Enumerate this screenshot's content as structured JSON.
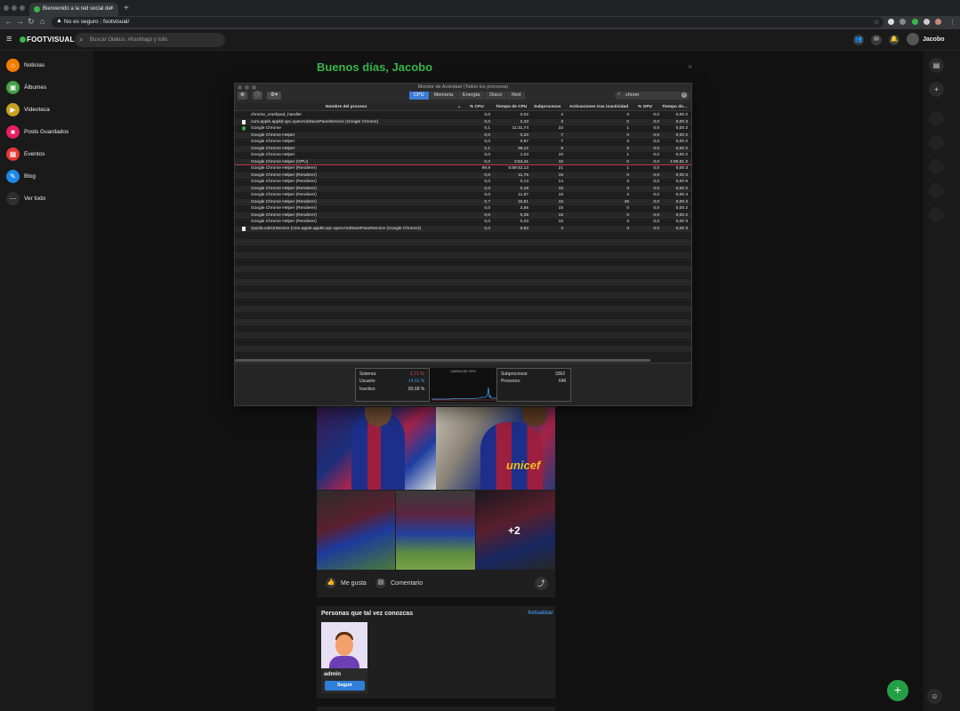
{
  "browser": {
    "tab_title": "Bienvenido a la red social del",
    "new_tab": "+",
    "security": "No es seguro",
    "url": "footvisual/"
  },
  "header": {
    "logo": "FOOTVISUAL",
    "search_placeholder": "Buscar Otakus, #hashtags y tolis",
    "username": "Jacobo"
  },
  "sidebar": {
    "items": [
      {
        "label": "Noticias",
        "color": "#f57c00",
        "icon": "home-icon"
      },
      {
        "label": "Álbumes",
        "color": "#43a047",
        "icon": "albums-icon"
      },
      {
        "label": "Videoteca",
        "color": "#c8a020",
        "icon": "video-icon"
      },
      {
        "label": "Posts Guardados",
        "color": "#e91e63",
        "icon": "bookmark-icon"
      },
      {
        "label": "Eventos",
        "color": "#e53935",
        "icon": "calendar-icon"
      },
      {
        "label": "Blog",
        "color": "#1e88e5",
        "icon": "blog-icon"
      },
      {
        "label": "Ver todo",
        "color": "#2e2e2e",
        "icon": "more-icon"
      }
    ]
  },
  "feed": {
    "greeting": "Buenos días, Jacobo",
    "more_photos": "+2",
    "jersey_text": "unicef",
    "like_label": "Me gusta",
    "comment_label": "Comentario"
  },
  "suggestions": {
    "title": "Personas que tal vez conozcas",
    "refresh": "Actualizar",
    "person_name": "admin",
    "follow_label": "Seguir"
  },
  "activity_monitor": {
    "title": "Monitor de Actividad (Todos los procesos)",
    "tabs": [
      "CPU",
      "Memoria",
      "Energía",
      "Disco",
      "Red"
    ],
    "active_tab": "CPU",
    "search_value": "chrom",
    "columns": [
      "Nombre del proceso",
      "% CPU",
      "Tiempo de CPU",
      "Subprocesos",
      "Activaciones tras inactividad",
      "% GPU",
      "Tiempo de..."
    ],
    "rows": [
      {
        "name": "chrome_crashpad_handler",
        "icon": "",
        "cpu": "0,0",
        "time": "0,02",
        "threads": "4",
        "wakeups": "0",
        "gpu": "0,0",
        "gtime": "0,00 2"
      },
      {
        "name": "com.apple.appkit.xpc.openAndSavePanelService (Google Chrome)",
        "icon": "doc",
        "cpu": "0,0",
        "time": "2,43",
        "threads": "3",
        "wakeups": "0",
        "gpu": "0,0",
        "gtime": "0,00 3"
      },
      {
        "name": "Google Chrome",
        "icon": "chrome",
        "cpu": "0,1",
        "time": "11:31,74",
        "threads": "32",
        "wakeups": "1",
        "gpu": "0,0",
        "gtime": "0,00 2"
      },
      {
        "name": "Google Chrome Helper",
        "icon": "",
        "cpu": "0,0",
        "time": "0,20",
        "threads": "7",
        "wakeups": "0",
        "gpu": "0,0",
        "gtime": "0,00 2"
      },
      {
        "name": "Google Chrome Helper",
        "icon": "",
        "cpu": "0,0",
        "time": "0,87",
        "threads": "7",
        "wakeups": "0",
        "gpu": "0,0",
        "gtime": "0,00 2"
      },
      {
        "name": "Google Chrome Helper",
        "icon": "",
        "cpu": "0,1",
        "time": "38,12",
        "threads": "9",
        "wakeups": "6",
        "gpu": "0,0",
        "gtime": "0,00 2"
      },
      {
        "name": "Google Chrome Helper",
        "icon": "",
        "cpu": "0,0",
        "time": "1,03",
        "threads": "10",
        "wakeups": "1",
        "gpu": "0,0",
        "gtime": "0,00 2"
      },
      {
        "name": "Google Chrome Helper (GPU)",
        "icon": "",
        "cpu": "0,0",
        "time": "3:54,41",
        "threads": "10",
        "wakeups": "0",
        "gpu": "0,0",
        "gtime": "1:00,61 2"
      },
      {
        "name": "Google Chrome Helper (Renderer)",
        "icon": "",
        "cpu": "99,9",
        "time": "5:59:42,13",
        "threads": "21",
        "wakeups": "1",
        "gpu": "0,0",
        "gtime": "0,00 3",
        "selected": true
      },
      {
        "name": "Google Chrome Helper (Renderer)",
        "icon": "",
        "cpu": "0,0",
        "time": "11,75",
        "threads": "15",
        "wakeups": "0",
        "gpu": "0,0",
        "gtime": "0,00 3"
      },
      {
        "name": "Google Chrome Helper (Renderer)",
        "icon": "",
        "cpu": "0,0",
        "time": "0,13",
        "threads": "14",
        "wakeups": "0",
        "gpu": "0,0",
        "gtime": "0,00 6"
      },
      {
        "name": "Google Chrome Helper (Renderer)",
        "icon": "",
        "cpu": "0,0",
        "time": "0,18",
        "threads": "15",
        "wakeups": "0",
        "gpu": "0,0",
        "gtime": "0,00 2"
      },
      {
        "name": "Google Chrome Helper (Renderer)",
        "icon": "",
        "cpu": "0,0",
        "time": "11,87",
        "threads": "16",
        "wakeups": "4",
        "gpu": "0,0",
        "gtime": "0,00 4"
      },
      {
        "name": "Google Chrome Helper (Renderer)",
        "icon": "",
        "cpu": "0,7",
        "time": "15,81",
        "threads": "15",
        "wakeups": "46",
        "gpu": "0,0",
        "gtime": "0,00 4"
      },
      {
        "name": "Google Chrome Helper (Renderer)",
        "icon": "",
        "cpu": "0,0",
        "time": "3,56",
        "threads": "15",
        "wakeups": "0",
        "gpu": "0,0",
        "gtime": "0,00 2"
      },
      {
        "name": "Google Chrome Helper (Renderer)",
        "icon": "",
        "cpu": "0,0",
        "time": "0,39",
        "threads": "15",
        "wakeups": "0",
        "gpu": "0,0",
        "gtime": "0,00 2"
      },
      {
        "name": "Google Chrome Helper (Renderer)",
        "icon": "",
        "cpu": "0,0",
        "time": "0,33",
        "threads": "15",
        "wakeups": "0",
        "gpu": "0,0",
        "gtime": "0,00 3"
      },
      {
        "name": "QuickLookUIService (com.apple.appkit.xpc.openAndSavePanelService (Google Chrome))",
        "icon": "doc",
        "cpu": "0,0",
        "time": "0,63",
        "threads": "3",
        "wakeups": "0",
        "gpu": "0,0",
        "gtime": "0,00 3"
      }
    ],
    "stats": {
      "sistema_label": "Sistema:",
      "sistema_value": "1,71 %",
      "sistema_color": "#e05050",
      "usuario_label": "Usuario:",
      "usuario_value": "14,61 %",
      "usuario_color": "#3d9be9",
      "inactivo_label": "Inactivo:",
      "inactivo_value": "83,68 %",
      "graph_label": "CARGA DE CPU",
      "subprocesos_label": "Subprocesos:",
      "subprocesos_value": "3362",
      "procesos_label": "Procesos:",
      "procesos_value": "646"
    }
  }
}
